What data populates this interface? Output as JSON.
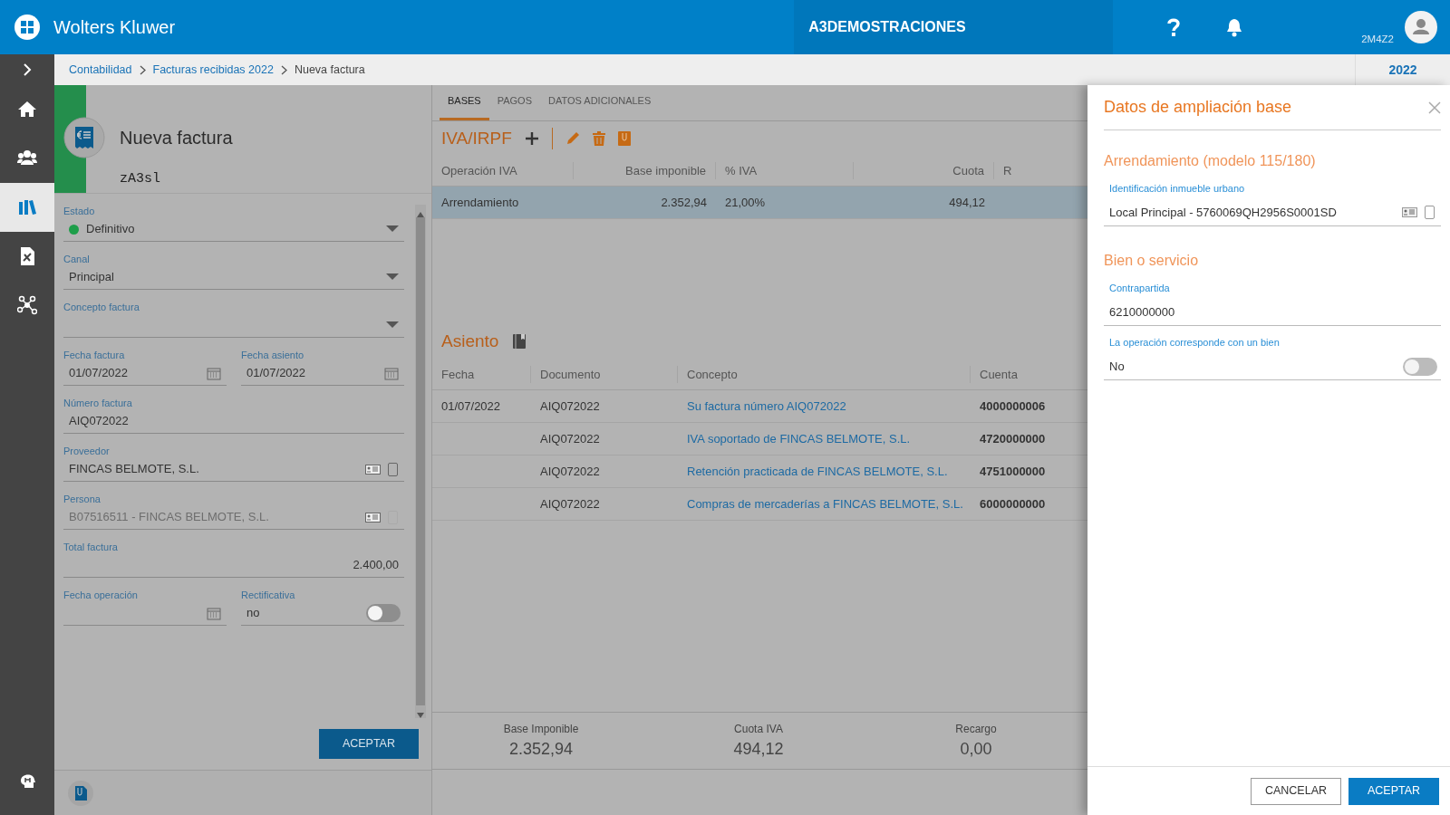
{
  "app": {
    "brand": "Wolters Kluwer",
    "company": "A3DEMOSTRACIONES",
    "user": "2M4Z2"
  },
  "breadcrumb": {
    "items": [
      {
        "label": "Contabilidad",
        "current": false
      },
      {
        "label": "Facturas recibidas 2022",
        "current": false
      },
      {
        "label": "Nueva factura",
        "current": true
      }
    ],
    "year": "2022"
  },
  "sidebar": {
    "items": [
      {
        "selected": false
      },
      {
        "selected": false
      },
      {
        "selected": true
      },
      {
        "selected": false
      },
      {
        "selected": false
      }
    ]
  },
  "invoice": {
    "title": "Nueva factura",
    "code": "zA3sl",
    "rows": [
      [
        {
          "kind": "select",
          "label": "Estado",
          "value": "Definitivo",
          "color": "#1e9e4a"
        }
      ],
      [
        {
          "kind": "select",
          "label": "Canal",
          "value": "Principal"
        }
      ],
      [
        {
          "kind": "select",
          "label": "Concepto factura"
        }
      ],
      [
        {
          "kind": "date",
          "label": "Fecha factura",
          "value": "01/07/2022"
        },
        {
          "kind": "date",
          "label": "Fecha asiento",
          "value": "01/07/2022"
        }
      ],
      [
        {
          "kind": "text",
          "label": "Número factura",
          "value": "AIQ072022"
        }
      ],
      [
        {
          "kind": "lookup",
          "label": "Proveedor",
          "value": "FINCAS BELMOTE, S.L.",
          "disabled": false
        }
      ],
      [
        {
          "kind": "lookup",
          "label": "Persona",
          "value": "B07516511 - FINCAS BELMOTE, S.L.",
          "disabled": true
        }
      ],
      [
        {
          "kind": "number",
          "label": "Total factura",
          "value": "2.400,00"
        }
      ],
      [
        {
          "kind": "date",
          "label": "Fecha operación"
        },
        {
          "kind": "toggle",
          "label": "Rectificativa",
          "value": "no",
          "on": false
        }
      ]
    ],
    "accept": "ACEPTAR"
  },
  "tabs": [
    {
      "label": "BASES",
      "selected": true
    },
    {
      "label": "PAGOS",
      "selected": false
    },
    {
      "label": "DATOS ADICIONALES",
      "selected": false
    }
  ],
  "iva": {
    "title": "IVA/IRPF",
    "columns": [
      "Operación IVA",
      "Base imponible",
      "% IVA",
      "Cuota",
      "R"
    ],
    "rows": [
      {
        "cells": [
          "Arrendamiento",
          "2.352,94",
          "21,00%",
          "494,12"
        ],
        "selected": true
      }
    ]
  },
  "asiento": {
    "title": "Asiento",
    "columns": [
      "Fecha",
      "Documento",
      "Concepto",
      "Cuenta"
    ],
    "rows": [
      {
        "cells": [
          "01/07/2022",
          "AIQ072022",
          "Su factura número AIQ072022",
          "4000000006"
        ],
        "selected": false
      },
      {
        "cells": [
          "",
          "AIQ072022",
          "IVA soportado de FINCAS BELMOTE, S.L.",
          "4720000000"
        ],
        "selected": false
      },
      {
        "cells": [
          "",
          "AIQ072022",
          "Retención practicada de FINCAS BELMOTE, S.L.",
          "4751000000"
        ],
        "selected": false
      },
      {
        "cells": [
          "",
          "AIQ072022",
          "Compras de mercaderías a FINCAS BELMOTE, S.L.",
          "6000000000"
        ],
        "selected": false
      }
    ]
  },
  "totals": [
    {
      "label": "Base Imponible",
      "value": "2.352,94"
    },
    {
      "label": "Cuota IVA",
      "value": "494,12"
    },
    {
      "label": "Recargo",
      "value": "0,00"
    }
  ],
  "panel": {
    "title": "Datos de ampliación base",
    "sections": [
      {
        "title": "Arrendamiento (modelo 115/180)",
        "fields": [
          {
            "kind": "lookup",
            "label": "Identificación inmueble urbano",
            "value": "Local Principal - 5760069QH2956S0001SD",
            "disabled": false
          }
        ]
      },
      {
        "title": "Bien o servicio",
        "fields": [
          {
            "kind": "text",
            "label": "Contrapartida",
            "value": "6210000000"
          },
          {
            "kind": "toggle",
            "label": "La operación corresponde con un bien",
            "value": "No",
            "on": false
          }
        ]
      }
    ],
    "cancel": "CANCELAR",
    "accept": "ACEPTAR"
  }
}
